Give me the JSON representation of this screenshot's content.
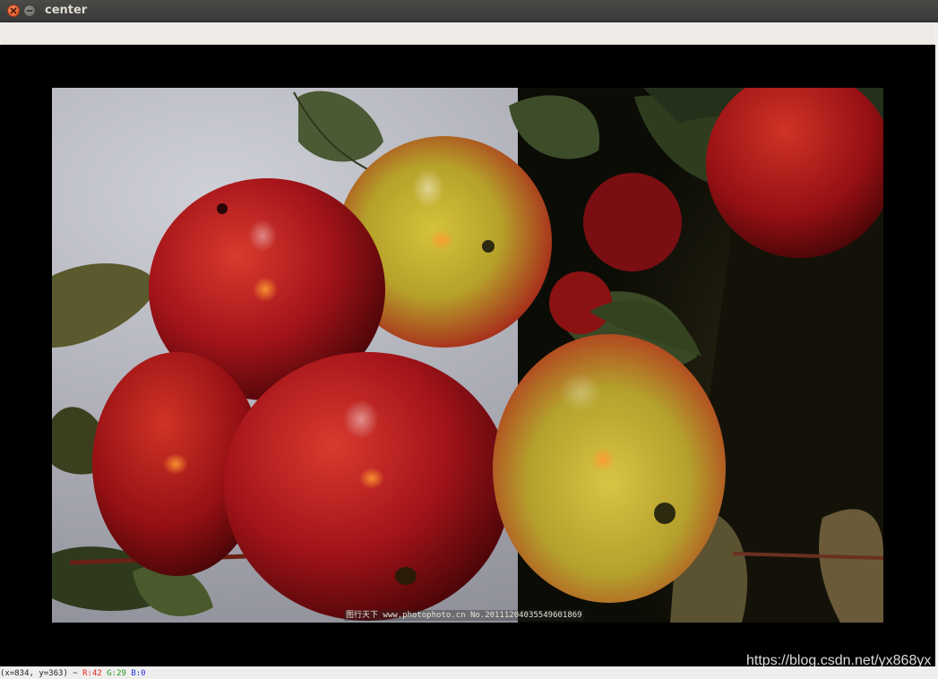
{
  "window": {
    "title": "center"
  },
  "image": {
    "description_icon": "apples-photo",
    "caption": "图行天下 www.photophoto.cn No.20111204035549601869"
  },
  "overlay": {
    "watermark": "https://blog.csdn.net/yx868yx"
  },
  "status": {
    "coords": "(x=834, y=363) ~",
    "r": "R:42",
    "g": "G:29",
    "b": "B:0"
  },
  "colors": {
    "titlebar": "#3c3c3a",
    "close_button": "#e5562a",
    "canvas_bg": "#000000",
    "r_text": "#e02020",
    "g_text": "#1a9a1a",
    "b_text": "#2030e0"
  }
}
